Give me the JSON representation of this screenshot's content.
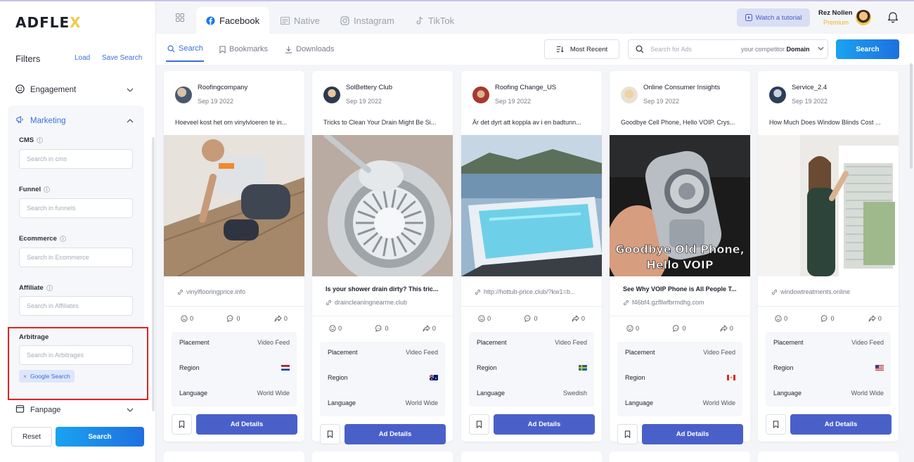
{
  "brand": {
    "logo_text_a": "ADFLE",
    "logo_text_x": "X"
  },
  "sidebar": {
    "filters_title": "Filters",
    "load_link": "Load",
    "save_search_link": "Save Search",
    "engagement_label": "Engagement",
    "marketing_label": "Marketing",
    "fields": [
      {
        "label": "CMS",
        "placeholder": "Search in cms"
      },
      {
        "label": "Funnel",
        "placeholder": "Search in funnels"
      },
      {
        "label": "Ecommerce",
        "placeholder": "Search in Ecommerce"
      },
      {
        "label": "Affiliate",
        "placeholder": "Search in Affiliates"
      },
      {
        "label": "Arbitrage",
        "placeholder": "Search in Arbitrages"
      }
    ],
    "arbitrage_tag": "Google Search",
    "fanpage_label": "Fanpage",
    "reset_label": "Reset",
    "search_label": "Search"
  },
  "topbar": {
    "tabs": [
      "Facebook",
      "Native",
      "Instagram",
      "TikTok"
    ],
    "active_tab": "Facebook",
    "watch_label": "Watch a tutorial",
    "user_name": "Rez Nollen",
    "user_tier": "Premium"
  },
  "subbar": {
    "tabs": [
      "Search",
      "Bookmarks",
      "Downloads"
    ],
    "active_tab": "Search",
    "sort_label": "Most Recent",
    "search_placeholder": "Search for Ads",
    "domain_prefix": "your competitor",
    "domain_label": "Domain",
    "search_button": "Search"
  },
  "labels": {
    "placement": "Placement",
    "region": "Region",
    "language": "Language",
    "ad_details": "Ad Details"
  },
  "colors": {
    "accent": "#3b6fd8",
    "primary_button": "#4a60c9",
    "highlight_border": "#e02323",
    "premium": "#f0b429"
  },
  "cards": [
    {
      "name": "Roofingcompany",
      "date": "Sep 19 2022",
      "text": "Hoeveel kost het om vinylvloeren te in...",
      "headline": "",
      "link": "vinylflooringprice.info",
      "likes": "0",
      "comments": "0",
      "shares": "0",
      "placement": "Video Feed",
      "region_flag": "NL",
      "language": "World Wide"
    },
    {
      "name": "SolBettery Club",
      "date": "Sep 19 2022",
      "text": "Tricks to Clean Your Drain Might Be Si...",
      "headline": "Is your shower drain dirty? This tric...",
      "link": "draincleaningnearme.club",
      "likes": "0",
      "comments": "0",
      "shares": "0",
      "placement": "Video Feed",
      "region_flag": "AU",
      "language": "World Wide"
    },
    {
      "name": "Roofing Change_US",
      "date": "Sep 19 2022",
      "text": "Är det dyrt att koppla av i en badtunn...",
      "headline": "",
      "link": "http://hottub-price.club/?kw1=b...",
      "likes": "0",
      "comments": "0",
      "shares": "0",
      "placement": "Video Feed",
      "region_flag": "SE",
      "language": "Swedish"
    },
    {
      "name": "Online Consumer Insights",
      "date": "Sep 19 2022",
      "text": "Goodbye Cell Phone, Hello VOIP. Crys...",
      "headline": "See Why VOIP Phone is All People T...",
      "link": "f46bf4.gzfllwfbrmdhg.com",
      "overlay_line1": "Goodbye Old Phone,",
      "overlay_line2": "Hello VOIP",
      "likes": "0",
      "comments": "0",
      "shares": "0",
      "placement": "Video Feed",
      "region_flag": "CA",
      "language": "World Wide"
    },
    {
      "name": "Service_2.4",
      "date": "Sep 19 2022",
      "text": "How Much Does Window Blinds Cost ...",
      "headline": "",
      "link": "windowtreatments.online",
      "likes": "0",
      "comments": "0",
      "shares": "0",
      "placement": "Video Feed",
      "region_flag": "US",
      "language": "World Wide"
    }
  ]
}
